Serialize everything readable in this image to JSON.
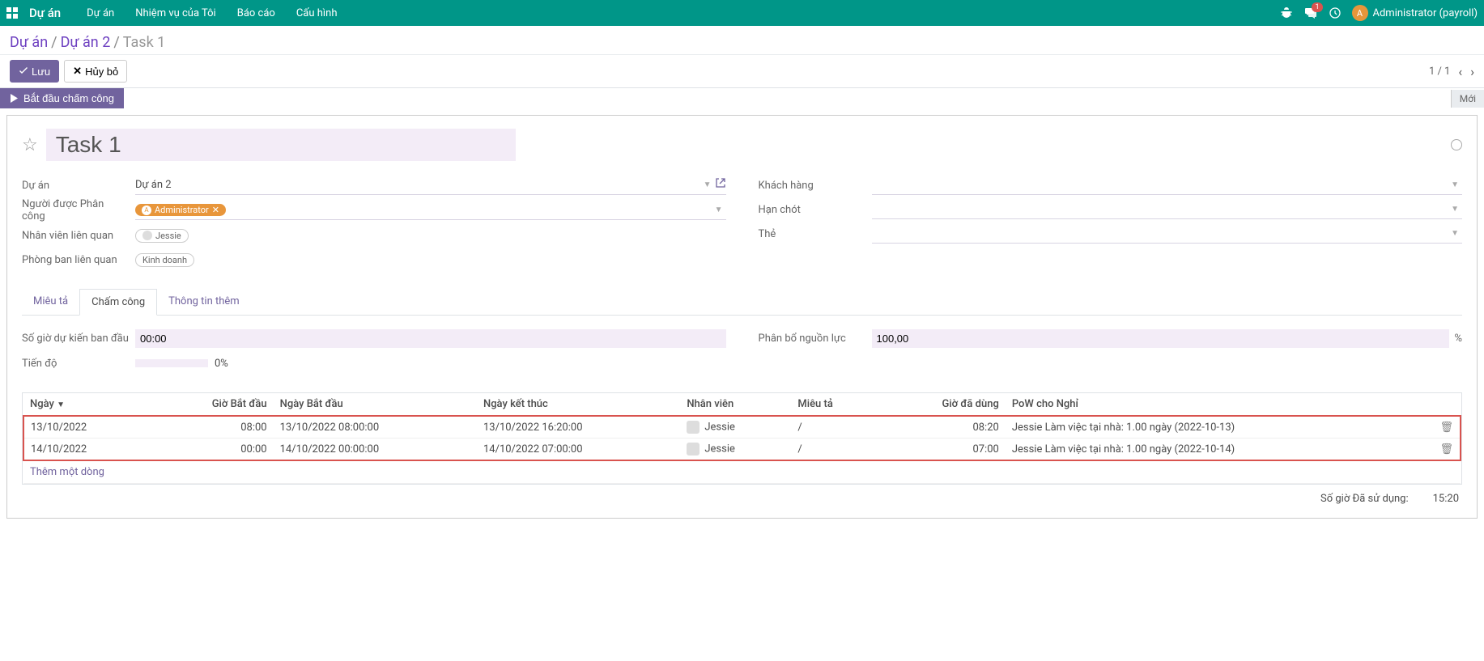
{
  "nav": {
    "brand": "Dự án",
    "items": [
      "Dự án",
      "Nhiệm vụ của Tôi",
      "Báo cáo",
      "Cấu hình"
    ],
    "msg_badge": "1",
    "user_initial": "A",
    "user_name": "Administrator (payroll)"
  },
  "breadcrumb": {
    "root": "Dự án",
    "parent": "Dự án 2",
    "current": "Task 1"
  },
  "buttons": {
    "save": "Lưu",
    "discard": "Hủy bỏ",
    "start_timer": "Bắt đầu chấm công"
  },
  "pager": {
    "pos": "1 / 1"
  },
  "status": {
    "state": "Mới"
  },
  "title": "Task 1",
  "fields": {
    "project_label": "Dự án",
    "project_value": "Dự án 2",
    "assignee_label": "Người được Phân công",
    "assignee_tag": "Administrator",
    "employee_label": "Nhân viên liên quan",
    "employee_tag": "Jessie",
    "dept_label": "Phòng ban liên quan",
    "dept_tag": "Kinh doanh",
    "customer_label": "Khách hàng",
    "deadline_label": "Hạn chót",
    "tags_label": "Thẻ"
  },
  "tabs": {
    "desc": "Miêu tả",
    "timesheet": "Chấm công",
    "extra": "Thông tin thêm"
  },
  "ts": {
    "planned_label": "Số giờ dự kiến ban đầu",
    "planned_value": "00:00",
    "progress_label": "Tiến độ",
    "progress_value": "0%",
    "alloc_label": "Phân bổ nguồn lực",
    "alloc_value": "100,00",
    "alloc_suffix": "%"
  },
  "table": {
    "cols": {
      "date": "Ngày",
      "start_time": "Giờ Bắt đầu",
      "start_dt": "Ngày Bắt đầu",
      "end_dt": "Ngày kết thúc",
      "emp": "Nhân viên",
      "desc": "Miêu tả",
      "hours": "Giờ đã dùng",
      "pow": "PoW cho Nghỉ"
    },
    "rows": [
      {
        "date": "13/10/2022",
        "start_time": "08:00",
        "start_dt": "13/10/2022 08:00:00",
        "end_dt": "13/10/2022 16:20:00",
        "emp": "Jessie",
        "desc": "/",
        "hours": "08:20",
        "pow": "Jessie Làm việc tại nhà: 1.00 ngày (2022-10-13)"
      },
      {
        "date": "14/10/2022",
        "start_time": "00:00",
        "start_dt": "14/10/2022 00:00:00",
        "end_dt": "14/10/2022 07:00:00",
        "emp": "Jessie",
        "desc": "/",
        "hours": "07:00",
        "pow": "Jessie Làm việc tại nhà: 1.00 ngày (2022-10-14)"
      }
    ],
    "add_line": "Thêm một dòng"
  },
  "footer": {
    "used_label": "Số giờ Đã sử dụng:",
    "used_value": "15:20"
  }
}
